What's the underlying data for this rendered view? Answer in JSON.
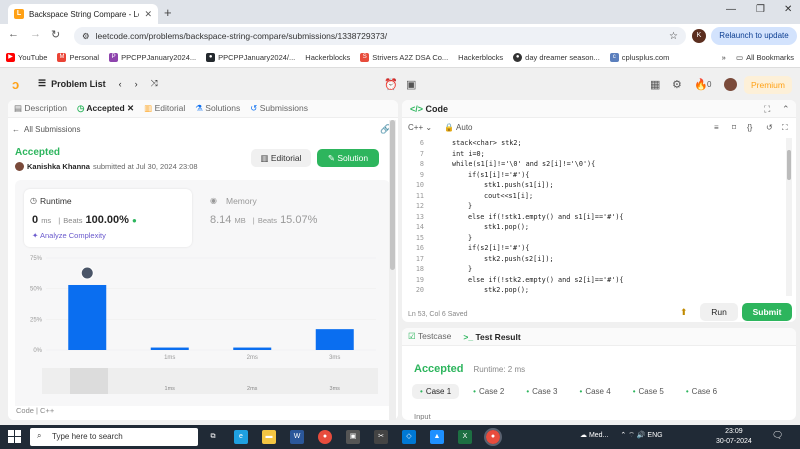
{
  "browser": {
    "tab_title": "Backspace String Compare - Le",
    "url": "leetcode.com/problems/backspace-string-compare/submissions/1338729373/",
    "profile_initial": "K",
    "relaunch_label": "Relaunch to update",
    "bookmarks": [
      {
        "label": "YouTube",
        "color": "#ff0000"
      },
      {
        "label": "Personal",
        "color": "#ea4335"
      },
      {
        "label": "PPCPPJanuary2024...",
        "color": "#8e44ad"
      },
      {
        "label": "PPCPPJanuary2024/...",
        "color": "#24292e"
      },
      {
        "label": "Hackerblocks",
        "color": "#ffffff"
      },
      {
        "label": "Strivers A2Z DSA Co...",
        "color": "#e74c3c"
      },
      {
        "label": "Hackerblocks",
        "color": "#ffffff"
      },
      {
        "label": "day dreamer season...",
        "color": "#333333"
      },
      {
        "label": "cplusplus.com",
        "color": "#5b7fbd"
      }
    ],
    "all_bookmarks": "All Bookmarks"
  },
  "lc_header": {
    "problem_list": "Problem List",
    "premium": "Premium",
    "fire_count": "0"
  },
  "left_tabs": [
    "Description",
    "Accepted",
    "Editorial",
    "Solutions",
    "Submissions"
  ],
  "submission": {
    "all_submissions": "All Submissions",
    "status": "Accepted",
    "author": "Kanishka Khanna",
    "submitted_text": "submitted at Jul 30, 2024 23:08",
    "editorial_btn": "Editorial",
    "solution_btn": "Solution",
    "runtime_label": "Runtime",
    "runtime_value": "0",
    "runtime_unit": "ms",
    "beats_label": "Beats",
    "runtime_beats": "100.00%",
    "analyze": "Analyze Complexity",
    "memory_label": "Memory",
    "memory_value": "8.14",
    "memory_unit": "MB",
    "memory_beats": "15.07%",
    "footer": "Code  |  C++"
  },
  "chart_data": {
    "type": "bar",
    "categories": [
      "",
      "1ms",
      "2ms",
      "3ms"
    ],
    "values": [
      53,
      2,
      2,
      17
    ],
    "y_ticks": [
      "75%",
      "50%",
      "25%",
      "0%"
    ],
    "ylim": [
      0,
      75
    ],
    "bar_color": "#0a6ef0",
    "selected_index": 0,
    "mini_labels": [
      "1ms",
      "2ms",
      "3ms"
    ]
  },
  "code_panel": {
    "title": "Code",
    "language": "C++",
    "mode": "Auto",
    "footer": "Ln 53, Col 6    Saved",
    "run": "Run",
    "submit": "Submit",
    "lines": [
      {
        "n": "6",
        "indent": 0,
        "t": "stack<char> stk2;"
      },
      {
        "n": "7",
        "indent": 0,
        "t": "int i=0;"
      },
      {
        "n": "8",
        "indent": 0,
        "t": "while(s1[i]!='\\0' and s2[i]!='\\0'){"
      },
      {
        "n": "9",
        "indent": 1,
        "t": "if(s1[i]!='#'){"
      },
      {
        "n": "10",
        "indent": 2,
        "t": "stk1.push(s1[i]);"
      },
      {
        "n": "11",
        "indent": 2,
        "t": "cout<<s1[i];"
      },
      {
        "n": "12",
        "indent": 1,
        "t": "}"
      },
      {
        "n": "13",
        "indent": 1,
        "t": "else if(!stk1.empty() and s1[i]=='#'){"
      },
      {
        "n": "14",
        "indent": 2,
        "t": "stk1.pop();"
      },
      {
        "n": "15",
        "indent": 1,
        "t": "}"
      },
      {
        "n": "16",
        "indent": 1,
        "t": "if(s2[i]!='#'){"
      },
      {
        "n": "17",
        "indent": 2,
        "t": "stk2.push(s2[i]);"
      },
      {
        "n": "18",
        "indent": 1,
        "t": "}"
      },
      {
        "n": "19",
        "indent": 1,
        "t": "else if(!stk2.empty() and s2[i]=='#'){"
      },
      {
        "n": "20",
        "indent": 2,
        "t": "stk2.pop();"
      }
    ]
  },
  "result_panel": {
    "tab_testcase": "Testcase",
    "tab_result": "Test Result",
    "status": "Accepted",
    "runtime": "Runtime: 2 ms",
    "cases": [
      "Case 1",
      "Case 2",
      "Case 3",
      "Case 4",
      "Case 5",
      "Case 6"
    ],
    "input_label": "Input"
  },
  "taskbar": {
    "search_placeholder": "Type here to search",
    "weather": "Med...",
    "lang": "ENG",
    "time": "23:09",
    "date": "30-07-2024"
  }
}
